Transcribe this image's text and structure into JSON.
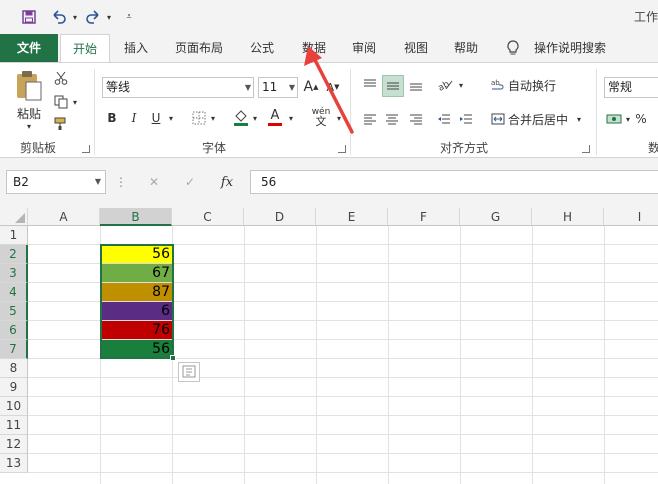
{
  "window": {
    "title": "工作"
  },
  "qat": {
    "save": "save-icon",
    "undo": "undo-icon",
    "redo": "redo-icon",
    "more": "customize-icon"
  },
  "tabs": [
    "文件",
    "开始",
    "插入",
    "页面布局",
    "公式",
    "数据",
    "审阅",
    "视图",
    "帮助",
    "操作说明搜索"
  ],
  "ribbon": {
    "clipboard": {
      "paste": "粘贴",
      "label": "剪贴板"
    },
    "font": {
      "name": "等线",
      "size": "11",
      "label": "字体",
      "bold": "B",
      "italic": "I",
      "underline": "U",
      "grow": "A",
      "shrink": "A",
      "font_color": "A",
      "phonetic": "wén"
    },
    "alignment": {
      "wrap": "自动换行",
      "merge": "合并后居中",
      "label": "对齐方式"
    },
    "number": {
      "format": "常规",
      "label": "数",
      "percent": "%"
    }
  },
  "formula_bar": {
    "name_box": "B2",
    "fx": "fx",
    "value": "56"
  },
  "columns": [
    "A",
    "B",
    "C",
    "D",
    "E",
    "F",
    "G",
    "H",
    "I"
  ],
  "rows": [
    "1",
    "2",
    "3",
    "4",
    "5",
    "6",
    "7",
    "8",
    "9",
    "10",
    "11",
    "12",
    "13"
  ],
  "cells": [
    {
      "ref": "B2",
      "value": "56",
      "fill": "#ffff00"
    },
    {
      "ref": "B3",
      "value": "67",
      "fill": "#70ad47"
    },
    {
      "ref": "B4",
      "value": "87",
      "fill": "#bf8f00"
    },
    {
      "ref": "B5",
      "value": "6",
      "fill": "#5b2c83"
    },
    {
      "ref": "B6",
      "value": "76",
      "fill": "#c00000"
    },
    {
      "ref": "B7",
      "value": "56",
      "fill": "#1a7f3c"
    }
  ],
  "colors": {
    "accent": "#217346",
    "annotation_arrow": "#e8413c"
  }
}
